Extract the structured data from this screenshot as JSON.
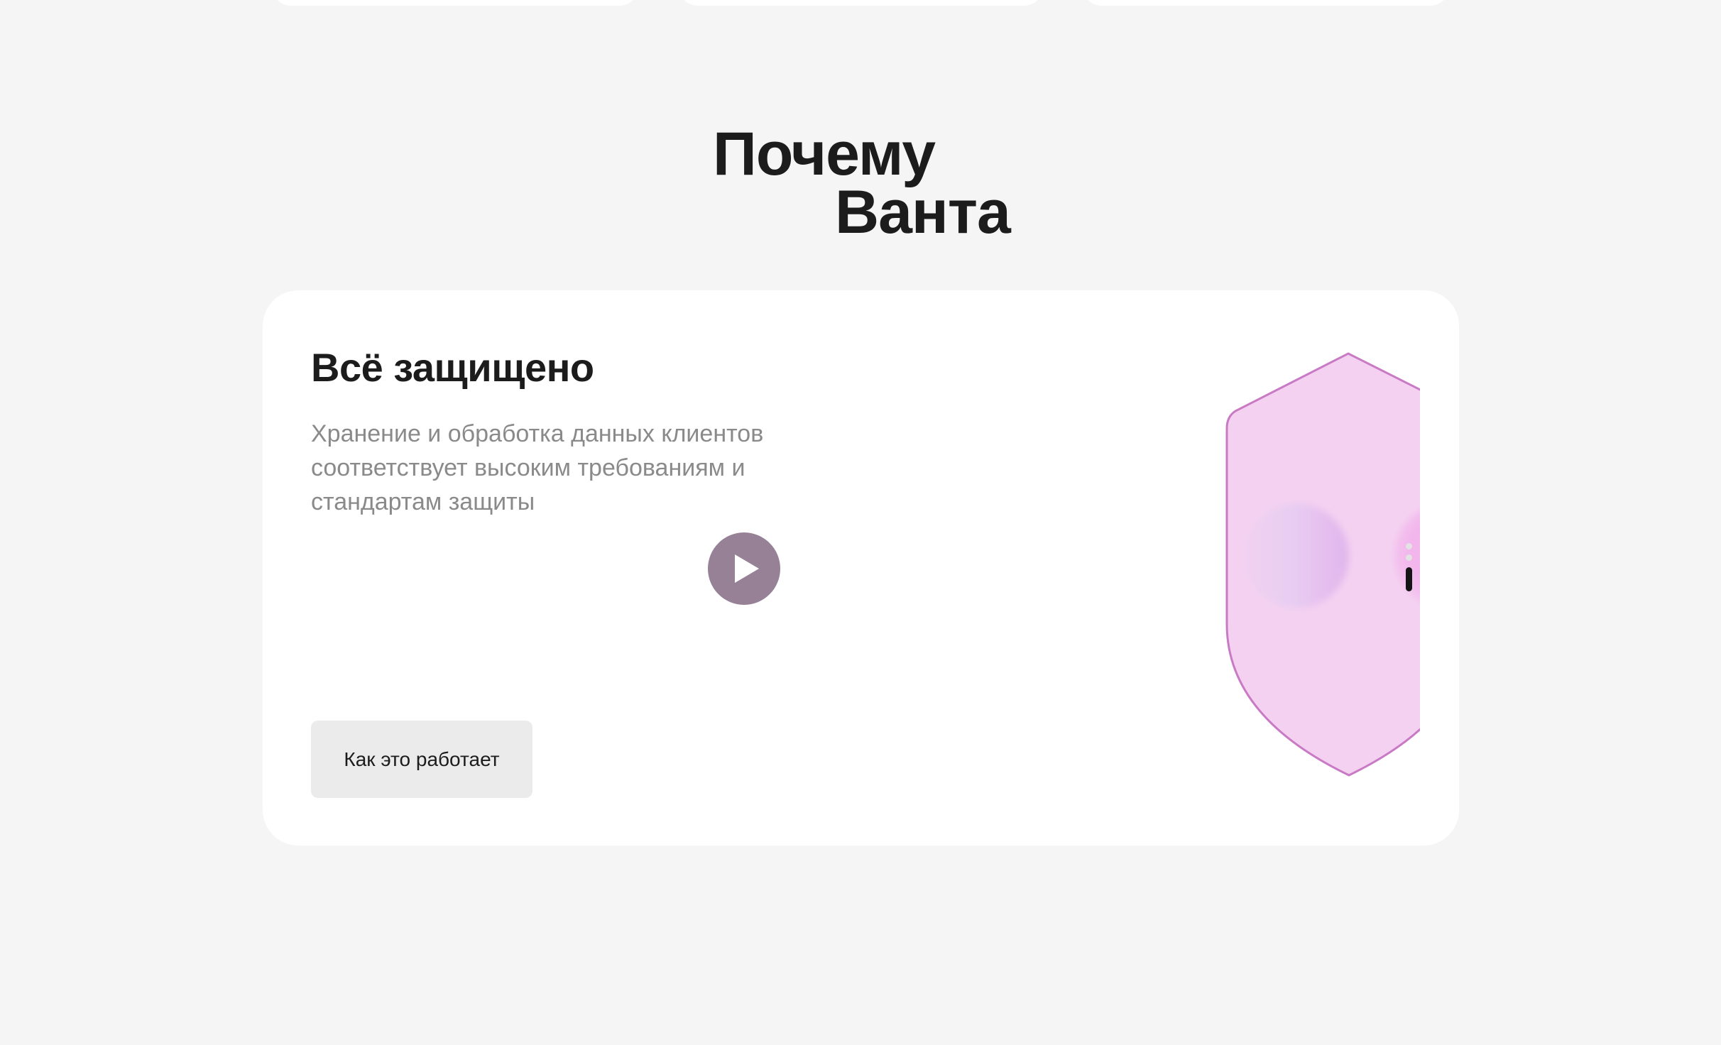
{
  "section": {
    "title_line1": "Почему",
    "title_line2": "Ванта"
  },
  "feature": {
    "heading": "Всё защищено",
    "description": "Хранение и обработка данных клиентов соответствует высоким требованиям и стандартам защиты",
    "cta_label": "Как это работает"
  },
  "media": {
    "illustration": "shield-icon",
    "play_icon": "play-icon",
    "orbs": [
      "cyan-violet",
      "magenta",
      "plum-black"
    ]
  },
  "pager": {
    "total": 3,
    "active_index": 2
  },
  "colors": {
    "page_background": "#f5f5f5",
    "card_background": "#ffffff",
    "shield_fill": "#f2c9ef",
    "shield_stroke": "#c97ac4",
    "text_primary": "#1c1c1c",
    "text_secondary": "#8a8a8a",
    "button_background": "#ebebeb"
  }
}
